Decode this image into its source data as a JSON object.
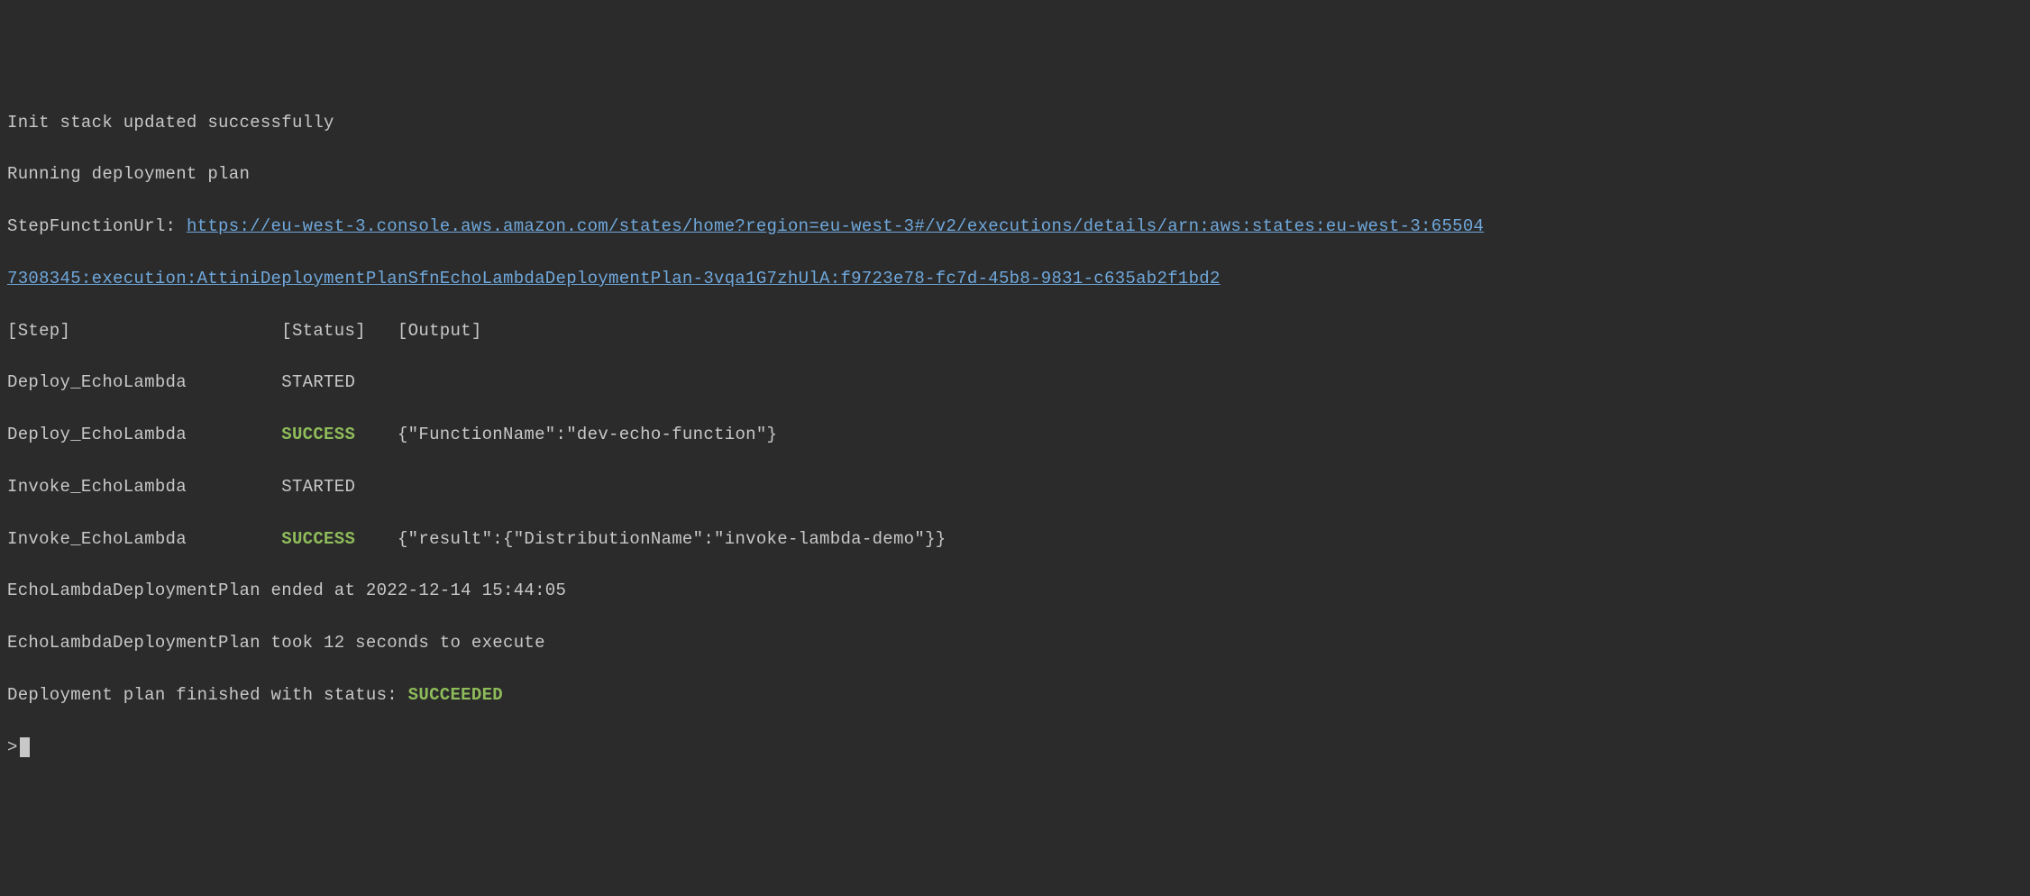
{
  "lines": {
    "l1": "Init stack updated successfully",
    "l2": "Running deployment plan",
    "l3_prefix": "StepFunctionUrl: ",
    "l3_link": "https://eu-west-3.console.aws.amazon.com/states/home?region=eu-west-3#/v2/executions/details/arn:aws:states:eu-west-3:65504",
    "l4_link": "7308345:execution:AttiniDeploymentPlanSfnEchoLambdaDeploymentPlan-3vqa1G7zhUlA:f9723e78-fc7d-45b8-9831-c635ab2f1bd2",
    "header": {
      "step": "[Step]",
      "status": "[Status]",
      "output": "[Output]"
    },
    "rows": [
      {
        "step": "Deploy_EchoLambda",
        "status": "STARTED",
        "output": ""
      },
      {
        "step": "Deploy_EchoLambda",
        "status": "SUCCESS",
        "output": "{\"FunctionName\":\"dev-echo-function\"}"
      },
      {
        "step": "Invoke_EchoLambda",
        "status": "STARTED",
        "output": ""
      },
      {
        "step": "Invoke_EchoLambda",
        "status": "SUCCESS",
        "output": "{\"result\":{\"DistributionName\":\"invoke-lambda-demo\"}}"
      }
    ],
    "l10": "EchoLambdaDeploymentPlan ended at 2022-12-14 15:44:05",
    "l11": "EchoLambdaDeploymentPlan took 12 seconds to execute",
    "l12_prefix": "Deployment plan finished with status: ",
    "l12_status": "SUCCEEDED",
    "prompt": ">"
  },
  "layout": {
    "step_width": 26,
    "status_width": 11
  }
}
